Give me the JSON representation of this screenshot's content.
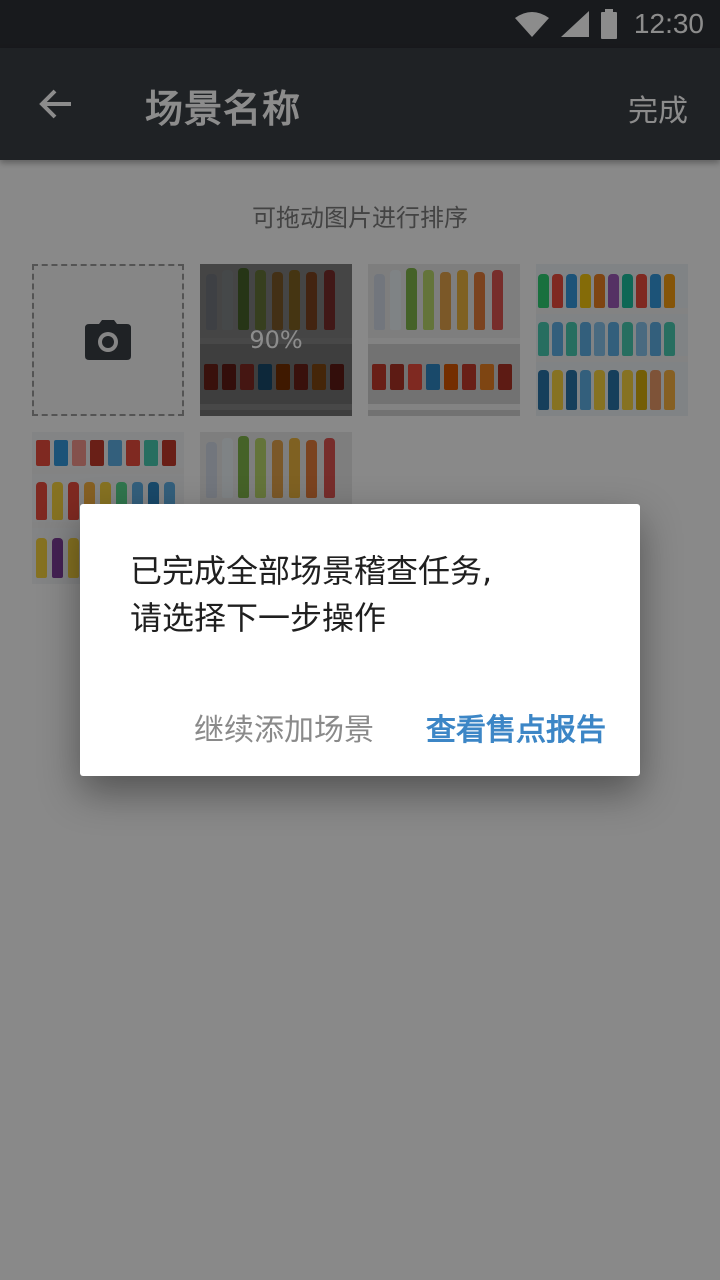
{
  "status_bar": {
    "time": "12:30",
    "icons": [
      "wifi-icon",
      "signal-icon",
      "battery-icon"
    ]
  },
  "app_bar": {
    "back_icon": "arrow-left-icon",
    "title": "场景名称",
    "done_label": "完成"
  },
  "content": {
    "hint": "可拖动图片进行排序",
    "add_photo_icon": "camera-icon",
    "photos": [
      {
        "name": "photo-1",
        "progress_label": "90%"
      },
      {
        "name": "photo-2"
      },
      {
        "name": "photo-3"
      },
      {
        "name": "photo-4"
      },
      {
        "name": "photo-5"
      }
    ]
  },
  "dialog": {
    "message_line1": "已完成全部场景稽查任务,",
    "message_line2": "请选择下一步操作",
    "neutral_button": "继续添加场景",
    "primary_button": "查看售点报告"
  },
  "colors": {
    "app_bar": "#3a3e44",
    "status_bar": "#2d3035",
    "accent": "#3c86c6"
  }
}
